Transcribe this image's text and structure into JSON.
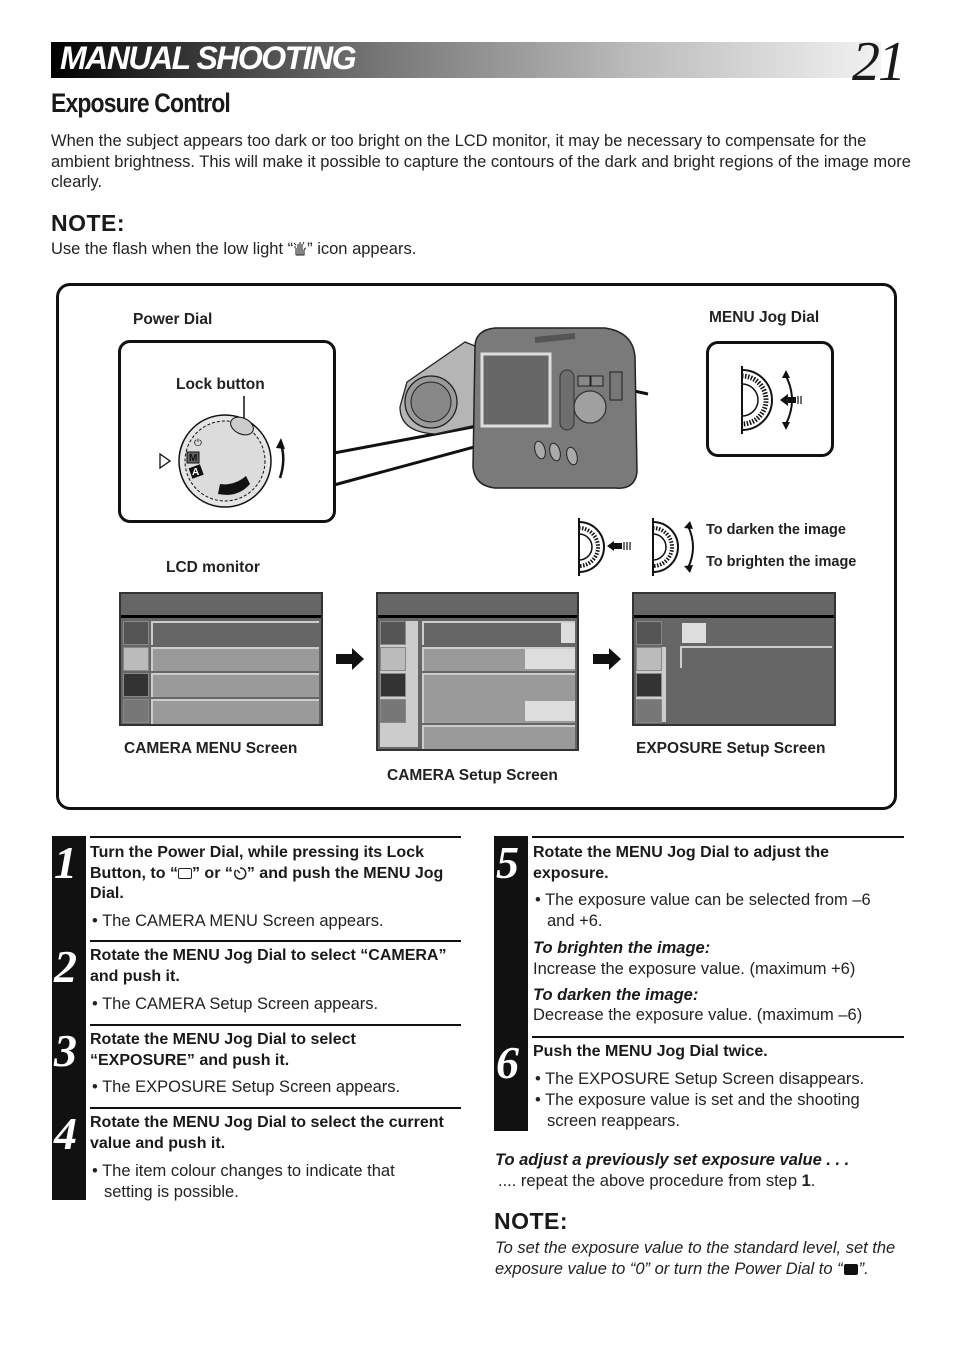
{
  "header": {
    "section": "MANUAL SHOOTING",
    "page_number": "21"
  },
  "title": "Exposure Control",
  "intro": "When the subject appears too dark or too bright on the LCD monitor, it may be necessary to compensate for the ambient brightness. This will make it possible to capture the contours of the dark and bright regions of the image more clearly.",
  "note1": {
    "heading": "NOTE:",
    "text_before": "Use the flash when the low light “",
    "icon": "low-light-hand-icon",
    "text_after": "” icon appears."
  },
  "diagram": {
    "power_dial_label": "Power Dial",
    "lock_button_label": "Lock button",
    "dial_marks": [
      "⏻",
      "M",
      "A"
    ],
    "menu_jog_dial_label": "MENU Jog Dial",
    "lcd_monitor_label": "LCD monitor",
    "darken_label": "To darken the image",
    "brighten_label": "To brighten the image",
    "screens": [
      {
        "label": "CAMERA MENU Screen"
      },
      {
        "label": "CAMERA Setup Screen"
      },
      {
        "label": "EXPOSURE Setup Screen"
      }
    ]
  },
  "steps": [
    {
      "number": "1",
      "title_parts": [
        "Turn the Power Dial, while pressing its Lock Button, to “",
        "” or “",
        "” and push the MENU Jog Dial."
      ],
      "title_icons": [
        "still-frame-icon",
        "self-timer-icon"
      ],
      "bullets": [
        "• The CAMERA MENU Screen appears."
      ]
    },
    {
      "number": "2",
      "title": "Rotate the MENU Jog Dial to select “CAMERA” and push it.",
      "bullets": [
        "• The CAMERA Setup Screen appears."
      ]
    },
    {
      "number": "3",
      "title": "Rotate the MENU Jog Dial to select “EXPOSURE” and push it.",
      "bullets": [
        "• The EXPOSURE Setup Screen appears."
      ]
    },
    {
      "number": "4",
      "title": "Rotate the MENU Jog Dial to select the current value and push it.",
      "bullets": [
        "• The item colour changes to indicate that setting is possible."
      ]
    },
    {
      "number": "5",
      "title": "Rotate the MENU Jog Dial to adjust the exposure.",
      "bullets": [
        "• The exposure value can be selected from –6 and +6."
      ],
      "sub": [
        {
          "heading": "To brighten the image:",
          "text": "Increase the exposure value. (maximum +6)"
        },
        {
          "heading": "To darken the image:",
          "text": "Decrease the exposure value. (maximum –6)"
        }
      ]
    },
    {
      "number": "6",
      "title": "Push the MENU Jog Dial twice.",
      "bullets": [
        "• The EXPOSURE Setup Screen disappears.",
        "• The exposure value is set and the shooting screen reappears."
      ]
    }
  ],
  "adjust": {
    "heading": "To adjust a previously set exposure value . . .",
    "text_before": ".... repeat the above procedure from step ",
    "step_ref": "1",
    "text_after": "."
  },
  "note2": {
    "heading": "NOTE:",
    "text": "To set the exposure value to the standard level, set the exposure value to “0” or turn the Power Dial to “",
    "icon": "auto-mode-square-icon",
    "text_after": "”."
  }
}
